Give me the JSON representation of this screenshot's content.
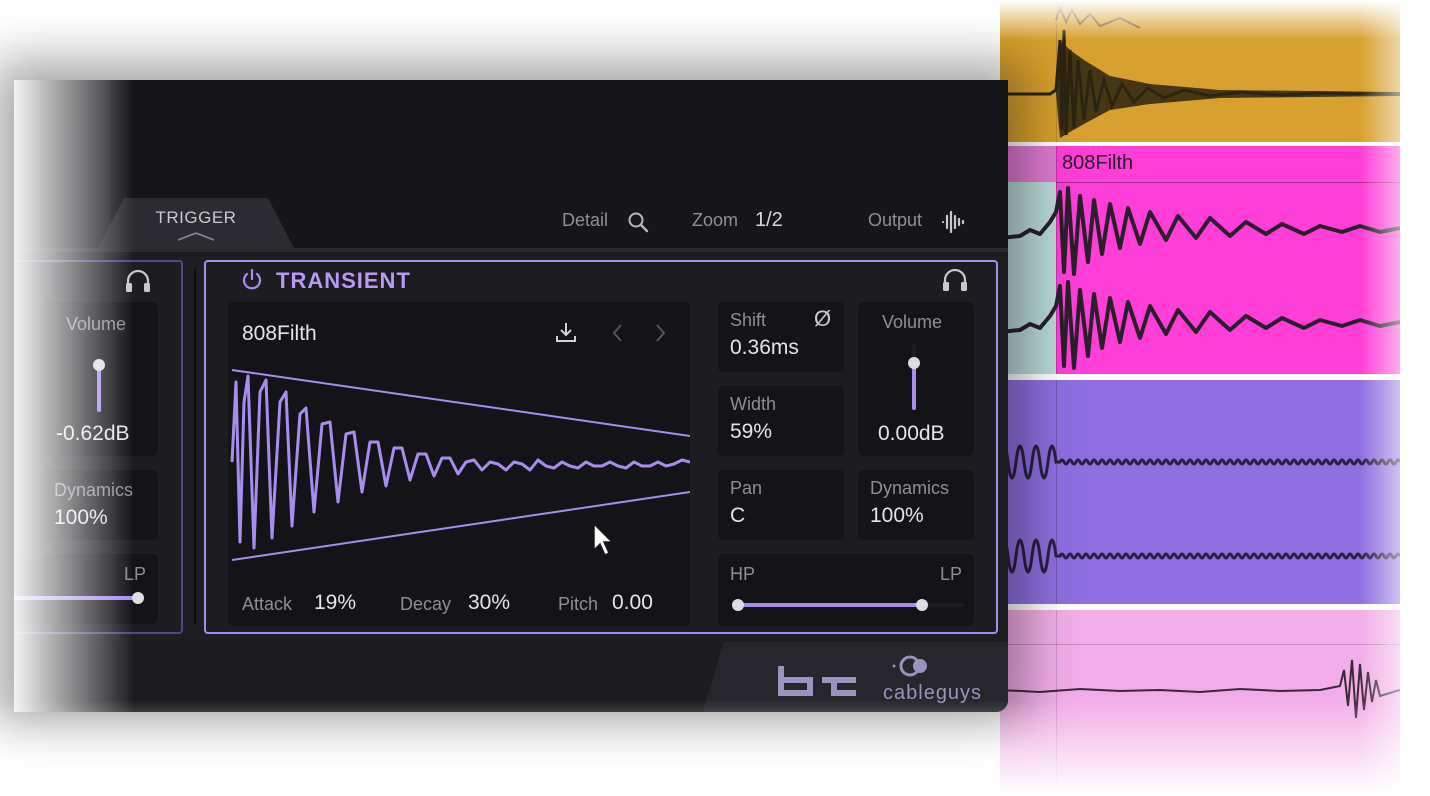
{
  "daw": {
    "clip_name": "808Filth",
    "colors": {
      "lane1": "#d8a02e",
      "lane2": "#ff3ed8",
      "lane3": "#8f6fe0",
      "lane4": "#f2aee8"
    }
  },
  "header": {
    "tab_trigger": "TRIGGER",
    "detail_label": "Detail",
    "zoom_label": "Zoom",
    "zoom_value": "1/2",
    "output_label": "Output"
  },
  "left_panel": {
    "volume_label": "Volume",
    "volume_value": "-0.62dB",
    "dynamics_label": "Dynamics",
    "dynamics_value": "100%",
    "lp_label": "LP"
  },
  "transient": {
    "title": "TRANSIENT",
    "sample_name": "808Filth",
    "attack_label": "Attack",
    "attack_value": "19%",
    "decay_label": "Decay",
    "decay_value": "30%",
    "pitch_label": "Pitch",
    "pitch_value": "0.00",
    "shift_label": "Shift",
    "shift_value": "0.36ms",
    "phase_symbol": "Ø",
    "width_label": "Width",
    "width_value": "59%",
    "pan_label": "Pan",
    "pan_value": "C",
    "volume_label": "Volume",
    "volume_value": "0.00dB",
    "dynamics_label": "Dynamics",
    "dynamics_value": "100%",
    "hp_label": "HP",
    "lp_label": "LP",
    "accent_color": "#a98cf0"
  },
  "footer": {
    "brand_logo": "bt",
    "vendor": "cableguys"
  },
  "icons": [
    "headphones-icon",
    "power-icon",
    "download-icon",
    "chevron-left-icon",
    "chevron-right-icon",
    "search-icon",
    "waveform-icon",
    "mouse-cursor-icon"
  ]
}
